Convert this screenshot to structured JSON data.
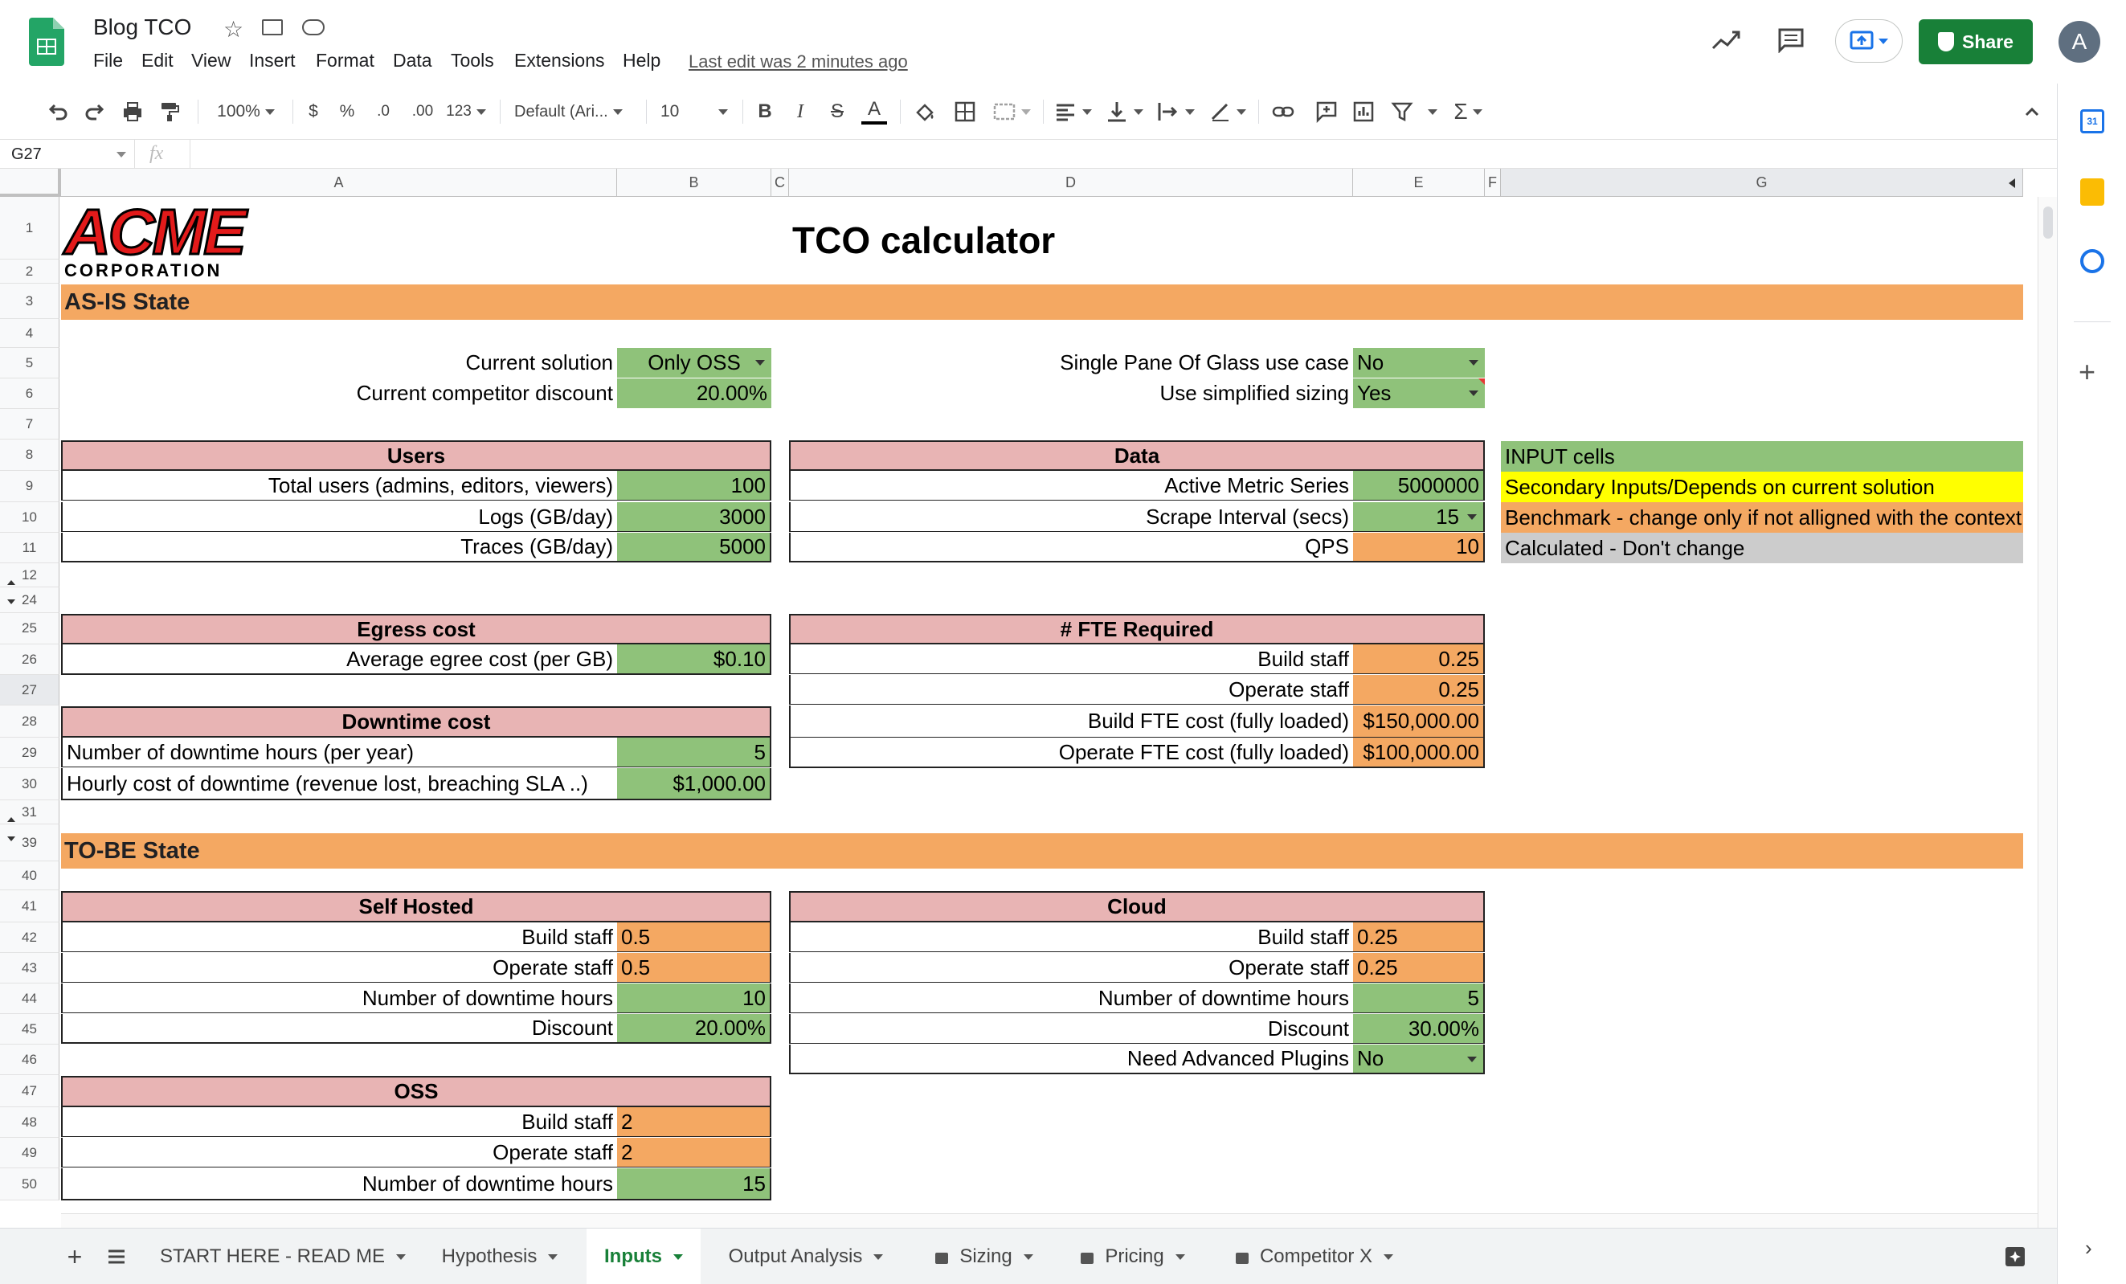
{
  "app": {
    "doc_title": "Blog TCO",
    "last_edit": "Last edit was 2 minutes ago",
    "share_label": "Share",
    "avatar_letter": "A",
    "menu": [
      "File",
      "Edit",
      "View",
      "Insert",
      "Format",
      "Data",
      "Tools",
      "Extensions",
      "Help"
    ]
  },
  "toolbar": {
    "zoom": "100%",
    "currency": "$",
    "percent": "%",
    "dec_decrease": ".0",
    "dec_increase": ".00",
    "more_formats": "123",
    "font": "Default (Ari...",
    "font_size": "10",
    "bold": "B",
    "italic": "I",
    "strike": "S",
    "text_color": "A"
  },
  "formula_bar": {
    "cell_ref": "G27",
    "fx": "fx",
    "value": ""
  },
  "columns": [
    "A",
    "B",
    "C",
    "D",
    "E",
    "F",
    "G"
  ],
  "rows": [
    "1",
    "2",
    "3",
    "4",
    "5",
    "6",
    "7",
    "8",
    "9",
    "10",
    "11",
    "12",
    "24",
    "25",
    "26",
    "27",
    "28",
    "29",
    "30",
    "31",
    "39",
    "40",
    "41",
    "42",
    "43",
    "44",
    "45",
    "46",
    "47",
    "48",
    "49",
    "50"
  ],
  "logo": {
    "word": "ACME",
    "sub": "CORPORATION"
  },
  "sheet": {
    "title": "TCO calculator",
    "asis_title": "AS-IS State",
    "tobe_title": "TO-BE State",
    "current_solution_label": "Current solution",
    "current_solution_value": "Only OSS",
    "competitor_discount_label": "Current competitor discount",
    "competitor_discount_value": "20.00%",
    "spog_label": "Single Pane Of Glass use case",
    "spog_value": "No",
    "simplified_label": "Use simplified sizing",
    "simplified_value": "Yes",
    "users": {
      "header": "Users",
      "total_label": "Total users (admins, editors, viewers)",
      "total_value": "100",
      "logs_label": "Logs (GB/day)",
      "logs_value": "3000",
      "traces_label": "Traces (GB/day)",
      "traces_value": "5000"
    },
    "data": {
      "header": "Data",
      "ams_label": "Active Metric Series",
      "ams_value": "5000000",
      "scrape_label": "Scrape Interval (secs)",
      "scrape_value": "15",
      "qps_label": "QPS",
      "qps_value": "10"
    },
    "legend": {
      "input": "INPUT cells",
      "secondary": "Secondary Inputs/Depends on current solution",
      "benchmark": "Benchmark - change only if not alligned with the context",
      "calculated": "Calculated - Don't change"
    },
    "egress": {
      "header": "Egress cost",
      "label": "Average egree cost (per GB)",
      "value": "$0.10"
    },
    "downtime": {
      "header": "Downtime cost",
      "hours_label": "Number of downtime hours (per year)",
      "hours_value": "5",
      "hourly_label": "Hourly cost of downtime (revenue lost, breaching SLA ..)",
      "hourly_value": "$1,000.00"
    },
    "fte": {
      "header": "# FTE Required",
      "build_label": "Build staff",
      "build_value": "0.25",
      "operate_label": "Operate staff",
      "operate_value": "0.25",
      "build_cost_label": "Build FTE cost (fully loaded)",
      "build_cost_value": "$150,000.00",
      "operate_cost_label": "Operate FTE cost (fully loaded)",
      "operate_cost_value": "$100,000.00"
    },
    "selfhosted": {
      "header": "Self Hosted",
      "build_label": "Build staff",
      "build_value": "0.5",
      "operate_label": "Operate staff",
      "operate_value": "0.5",
      "downtime_label": "Number of downtime hours",
      "downtime_value": "10",
      "discount_label": "Discount",
      "discount_value": "20.00%"
    },
    "cloud": {
      "header": "Cloud",
      "build_label": "Build staff",
      "build_value": "0.25",
      "operate_label": "Operate staff",
      "operate_value": "0.25",
      "downtime_label": "Number of downtime hours",
      "downtime_value": "5",
      "discount_label": "Discount",
      "discount_value": "30.00%",
      "plugins_label": "Need Advanced Plugins",
      "plugins_value": "No"
    },
    "oss": {
      "header": "OSS",
      "build_label": "Build staff",
      "build_value": "2",
      "operate_label": "Operate staff",
      "operate_value": "2",
      "downtime_label": "Number of downtime hours",
      "downtime_value": "15"
    }
  },
  "tabs": [
    "START HERE - READ ME",
    "Hypothesis",
    "Inputs",
    "Output Analysis",
    "Sizing",
    "Pricing",
    "Competitor X"
  ],
  "active_tab": "Inputs",
  "colors": {
    "input": "#8fc27a",
    "benchmark": "#f4a862",
    "header": "#e8b4b4",
    "secondary": "#ffff00",
    "calculated": "#cccccc",
    "brand": "#188038"
  }
}
